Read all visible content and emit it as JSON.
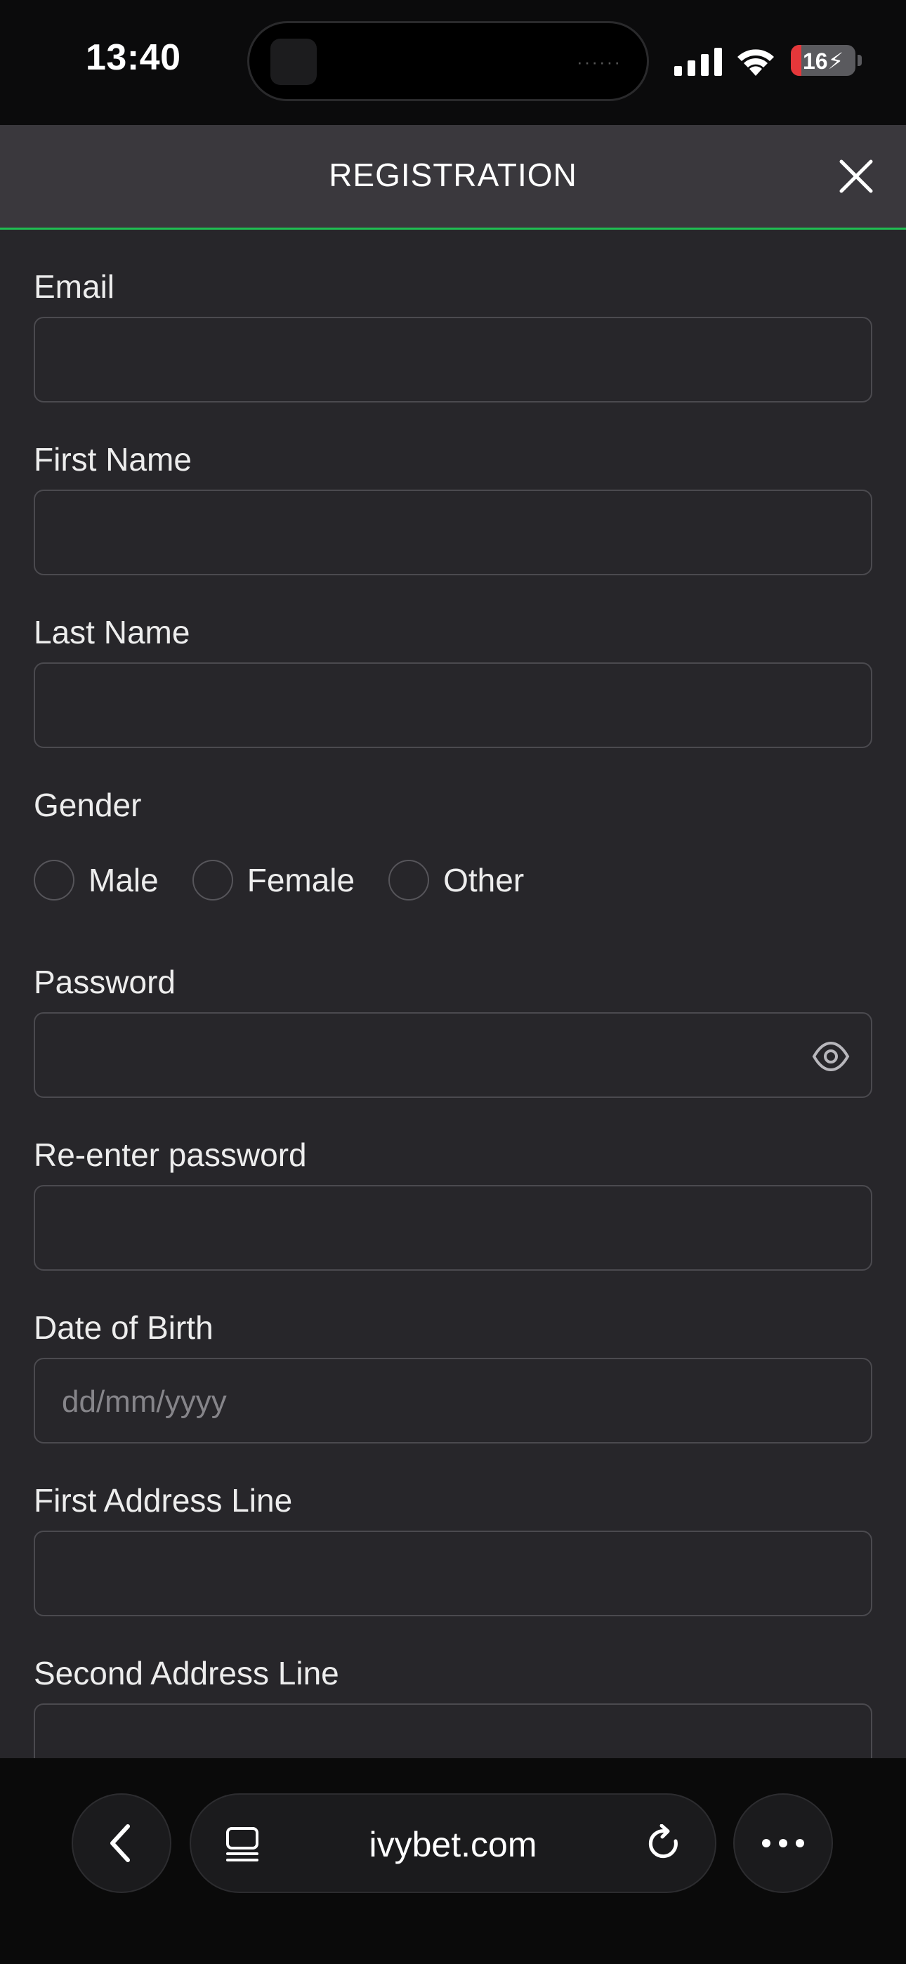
{
  "status_bar": {
    "time": "13:40",
    "battery": "16",
    "battery_level_percent": 16,
    "island_dots": "······"
  },
  "header": {
    "title": "REGISTRATION"
  },
  "form": {
    "email_label": "Email",
    "email_value": "",
    "first_name_label": "First Name",
    "first_name_value": "",
    "last_name_label": "Last Name",
    "last_name_value": "",
    "gender_label": "Gender",
    "gender_options": [
      "Male",
      "Female",
      "Other"
    ],
    "password_label": "Password",
    "password_value": "",
    "reenter_password_label": "Re-enter password",
    "reenter_password_value": "",
    "dob_label": "Date of Birth",
    "dob_placeholder": "dd/mm/yyyy",
    "address1_label": "First Address Line",
    "address1_value": "",
    "address2_label": "Second Address Line",
    "address2_value": ""
  },
  "browser": {
    "url": "ivybet.com"
  },
  "colors": {
    "accent_green": "#1fbe52",
    "header_bg": "#3a383d",
    "form_bg": "#27262a",
    "battery_red": "#e5373a"
  },
  "icons": {
    "close": "close-icon",
    "eye": "eye-icon",
    "back": "chevron-left-icon",
    "tabs": "tabs-icon",
    "reload": "reload-icon",
    "more": "more-icon"
  }
}
